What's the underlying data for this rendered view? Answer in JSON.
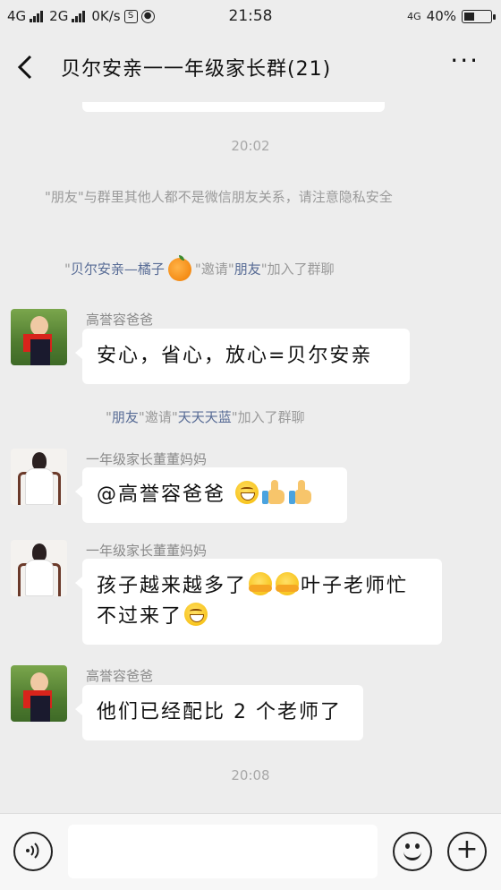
{
  "status_bar": {
    "network1": "4G",
    "network2": "2G",
    "speed": "0K/s",
    "time": "21:58",
    "net_right": "4G",
    "battery": "40%",
    "battery_level": 0.4
  },
  "header": {
    "back_icon": "chevron-left-icon",
    "title": "贝尔安亲一一年级家长群(21)",
    "more_icon": "more-dots-icon"
  },
  "chat": {
    "time1": "20:02",
    "system_notice": "\"朋友\"与群里其他人都不是微信朋友关系，请注意隐私安全",
    "invite1": {
      "q1": "\"",
      "inviter": "贝尔安亲—橘子",
      "q2": "\"邀请\"",
      "invitee": "朋友",
      "q3": "\"加入了群聊"
    },
    "msg1": {
      "sender": "高誉容爸爸",
      "text": "安心，省心，放心=贝尔安亲"
    },
    "invite2": {
      "q1": "\"",
      "inviter": "朋友",
      "q2": "\"邀请\"",
      "invitee": "天天天蓝",
      "q3": "\"加入了群聊"
    },
    "msg2": {
      "sender": "一年级家长董董妈妈",
      "text": "@高誉容爸爸"
    },
    "msg3": {
      "sender": "一年级家长董董妈妈",
      "text_a": "孩子越来越多了",
      "text_b": "叶子老师忙",
      "text_c": "不过来了"
    },
    "msg4": {
      "sender": "高誉容爸爸",
      "text": "他们已经配比 2 个老师了"
    },
    "time2": "20:08"
  },
  "input_bar": {
    "voice_icon": "voice-icon",
    "emoji_icon": "emoji-icon",
    "plus_icon": "plus-icon"
  }
}
